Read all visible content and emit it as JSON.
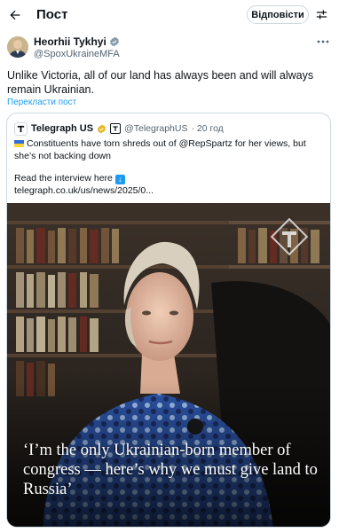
{
  "header": {
    "title": "Пост",
    "reply_label": "Відповісти",
    "back_icon": "arrow-left-icon",
    "settings_icon": "sliders-icon"
  },
  "author": {
    "name": "Heorhii Tykhyi",
    "handle": "@SpoxUkraineMFA",
    "verified_color": "#829aab"
  },
  "tweet": {
    "text": "Unlike Victoria, all of our land has always been and will always remain Ukrainian.",
    "translate_label": "Перекласти пост"
  },
  "quote": {
    "name": "Telegraph US",
    "handle": "@TelegraphUS",
    "time": "· 20 год",
    "text": "Constituents have torn shreds out of @RepSpartz for her views, but she’s not backing down",
    "read_line": "Read the interview here",
    "link": "telegraph.co.uk/us/news/2025/0...",
    "headline": "‘I’m the only Ukrainian-born member of congress — here’s why we must give land to Russia’"
  },
  "colors": {
    "accent": "#1d9bf0",
    "text": "#0f1419",
    "muted": "#536471",
    "border": "#cfd9de"
  }
}
